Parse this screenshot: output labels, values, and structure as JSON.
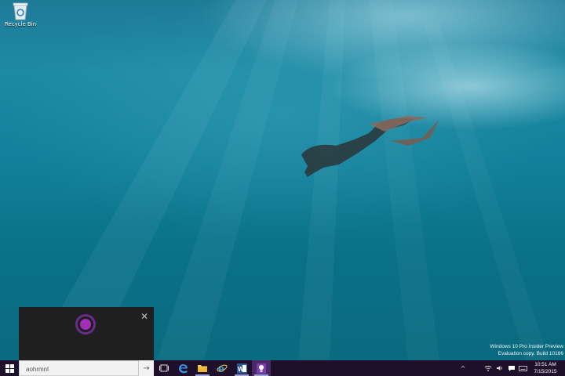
{
  "desktop": {
    "icons": [
      {
        "label": "Recycle Bin",
        "icon": "recycle-bin-icon"
      }
    ]
  },
  "watermark": {
    "line1": "Windows 10 Pro Insider Preview",
    "line2": "Evaluation copy. Build 10166"
  },
  "cortana": {
    "close_icon": "close-icon",
    "accent_color": "#a22fb7"
  },
  "taskbar": {
    "search_value": "aohrmnl",
    "search_go_icon": "arrow-right-icon",
    "pinned": [
      {
        "icon": "task-view-icon"
      },
      {
        "icon": "edge-icon"
      },
      {
        "icon": "file-explorer-icon"
      },
      {
        "icon": "internet-explorer-icon"
      },
      {
        "icon": "word-icon"
      },
      {
        "icon": "lightbulb-app-icon"
      }
    ],
    "tray": [
      {
        "icon": "chevron-up-icon"
      },
      {
        "icon": "wifi-icon"
      },
      {
        "icon": "volume-icon"
      },
      {
        "icon": "keyboard-icon"
      },
      {
        "icon": "action-center-icon"
      }
    ],
    "clock": {
      "time": "10:51 AM",
      "date": "7/15/2015"
    },
    "background_color": "#1e0f2b"
  }
}
